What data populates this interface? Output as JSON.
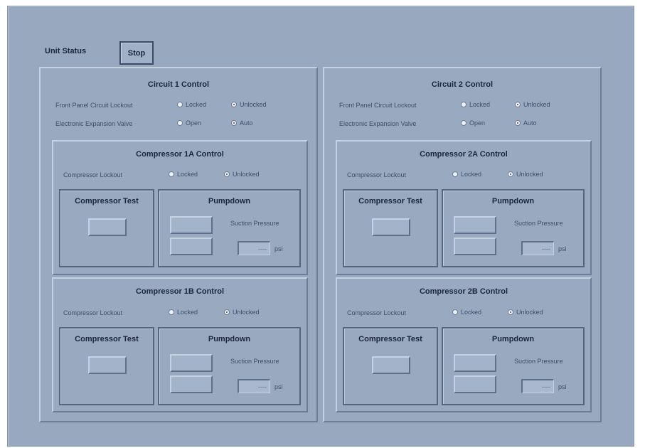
{
  "unit_status": {
    "label": "Unit Status",
    "button": "Stop"
  },
  "labels": {
    "front_panel_lockout": "Front Panel Circuit Lockout",
    "eev": "Electronic Expansion Valve",
    "compressor_lockout": "Compressor Lockout",
    "locked": "Locked",
    "unlocked": "Unlocked",
    "open": "Open",
    "auto": "Auto",
    "compressor_test": "Compressor Test",
    "pumpdown": "Pumpdown",
    "suction_pressure": "Suction Pressure",
    "psi": "psi",
    "suction_value": "----"
  },
  "circuits": [
    {
      "title": "Circuit 1 Control",
      "lockout_selected": "unlocked",
      "eev_selected": "auto",
      "compressors": [
        {
          "title": "Compressor 1A Control",
          "lockout_selected": "unlocked"
        },
        {
          "title": "Compressor 1B Control",
          "lockout_selected": "unlocked"
        }
      ]
    },
    {
      "title": "Circuit 2 Control",
      "lockout_selected": "unlocked",
      "eev_selected": "auto",
      "compressors": [
        {
          "title": "Compressor 2A Control",
          "lockout_selected": "unlocked"
        },
        {
          "title": "Compressor 2B Control",
          "lockout_selected": "unlocked"
        }
      ]
    }
  ]
}
